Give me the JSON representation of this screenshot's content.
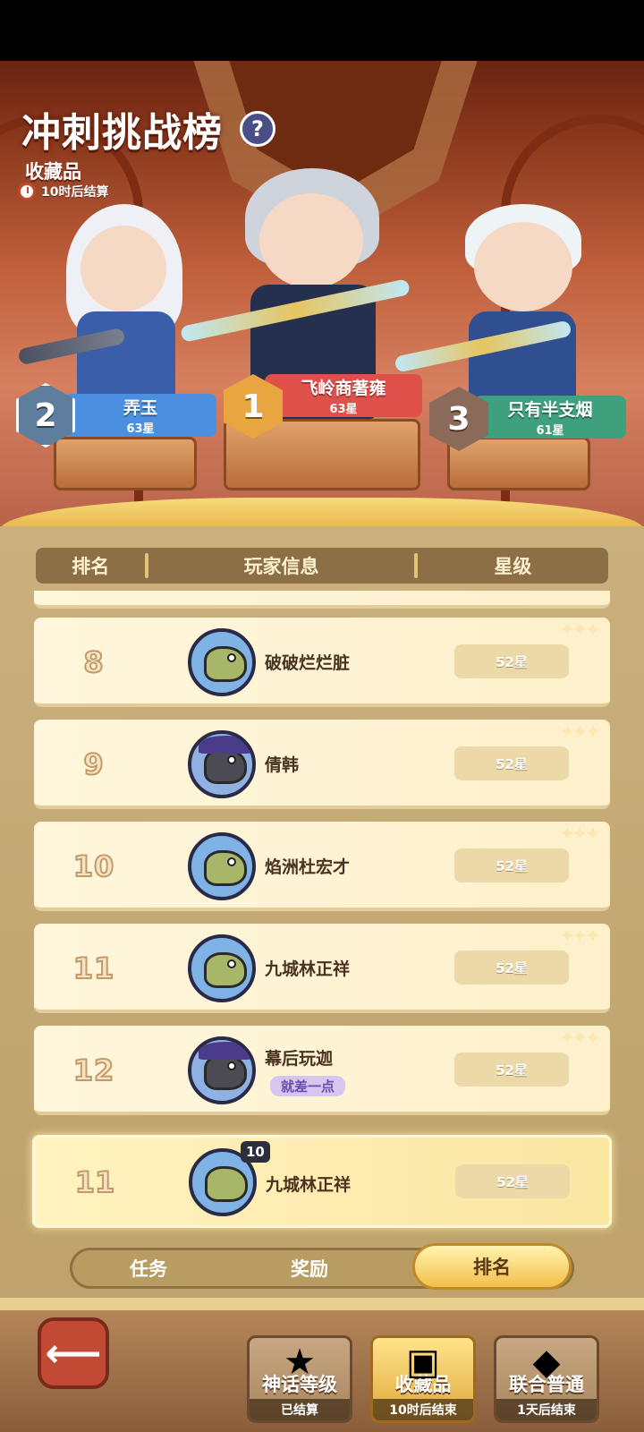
{
  "header": {
    "title": "冲刺挑战榜",
    "help_icon": "?",
    "category": "收藏品",
    "timer": "10时后结算"
  },
  "podium": [
    {
      "rank": "2",
      "name": "弄玉",
      "stars": "63星",
      "color": "#4b8fe0"
    },
    {
      "rank": "1",
      "name": "飞岭商著雍",
      "stars": "63星",
      "color": "#e0504a"
    },
    {
      "rank": "3",
      "name": "只有半支烟",
      "stars": "61星",
      "color": "#3fa07e"
    }
  ],
  "table": {
    "col_rank": "排名",
    "col_info": "玩家信息",
    "col_stars": "星级"
  },
  "rows": [
    {
      "rank": "8",
      "name": "破破烂烂脏",
      "stars": "52星",
      "avatar": "crocodile-avatar"
    },
    {
      "rank": "9",
      "name": "倩韩",
      "stars": "52星",
      "avatar": "wolf-avatar"
    },
    {
      "rank": "10",
      "name": "焰洲杜宏才",
      "stars": "52星",
      "avatar": "crocodile-avatar"
    },
    {
      "rank": "11",
      "name": "九城林正祥",
      "stars": "52星",
      "avatar": "crocodile-avatar"
    },
    {
      "rank": "12",
      "name": "幕后玩迦",
      "stars": "52星",
      "avatar": "wolf-avatar",
      "tag": "就差一点"
    }
  ],
  "my_row": {
    "rank": "11",
    "name": "九城林正祥",
    "stars": "52星",
    "level": "10"
  },
  "tabs": {
    "task": "任务",
    "reward": "奖励",
    "ranking": "排名"
  },
  "nav": {
    "back_icon": "back-arrow-icon",
    "items": [
      {
        "label": "神话等级",
        "sub": "已结算"
      },
      {
        "label": "收藏品",
        "sub": "10时后结束"
      },
      {
        "label": "联合普通",
        "sub": "1天后结束"
      }
    ]
  }
}
